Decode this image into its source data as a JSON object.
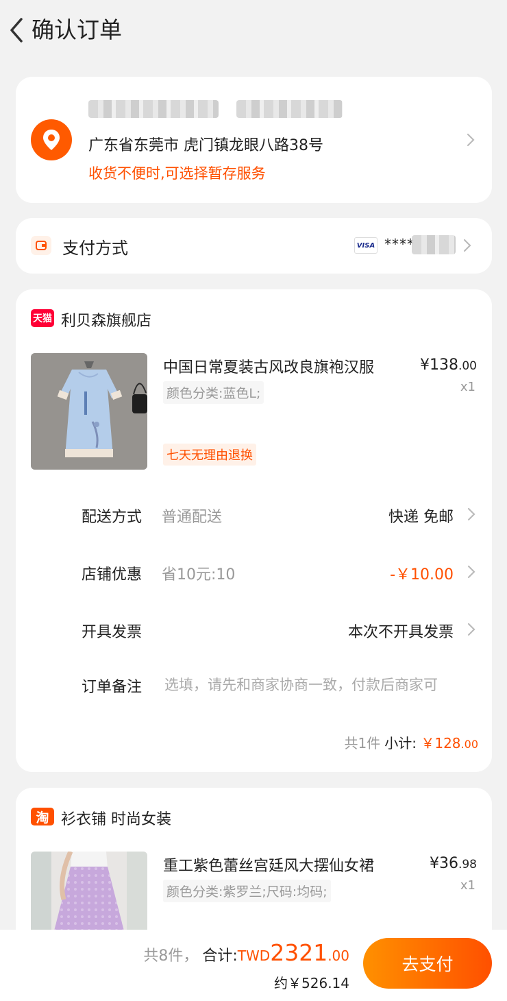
{
  "header": {
    "title": "确认订单"
  },
  "address": {
    "line": "广东省东莞市 虎门镇龙眼八路38号",
    "note": "收货不便时,可选择暂存服务"
  },
  "payment": {
    "label": "支付方式",
    "card_brand": "VISA",
    "card_number": "****"
  },
  "shops": [
    {
      "badge": "天猫",
      "name": "利贝森旗舰店",
      "product": {
        "title": "中国日常夏装古风改良旗袍汉服",
        "attributes": "颜色分类:蓝色L;",
        "price_main": "¥138",
        "price_cents": ".00",
        "quantity": "x1",
        "tag": "七天无理由退换"
      },
      "rows": [
        {
          "label": "配送方式",
          "desc": "普通配送",
          "value": "快递 免邮"
        },
        {
          "label": "店铺优惠",
          "desc": "省10元:10",
          "value": "-￥10.00"
        },
        {
          "label": "开具发票",
          "desc": "",
          "value": "本次不开具发票"
        },
        {
          "label": "订单备注",
          "placeholder": "选填，请先和商家协商一致，付款后商家可"
        }
      ],
      "subtotal": {
        "count": "共1件",
        "label": "小计:",
        "amount_main": "￥128",
        "amount_cents": ".00"
      }
    },
    {
      "badge": "淘",
      "name": "衫衣铺 时尚女装",
      "product": {
        "title": "重工紫色蕾丝宫廷风大摆仙女裙",
        "attributes": "颜色分类:紫罗兰;尺码:均码;",
        "price_main": "¥36",
        "price_cents": ".98",
        "quantity": "x1"
      }
    }
  ],
  "bottom": {
    "count": "共8件，",
    "label": "合计:",
    "currency": "TWD",
    "amount_main": "2321",
    "amount_cents": ".00",
    "approx": "约￥526.14",
    "pay_button": "去支付"
  },
  "colors": {
    "accent": "#ff5000",
    "background": "#f2f2f2",
    "tmall_red": "#ff0036"
  }
}
